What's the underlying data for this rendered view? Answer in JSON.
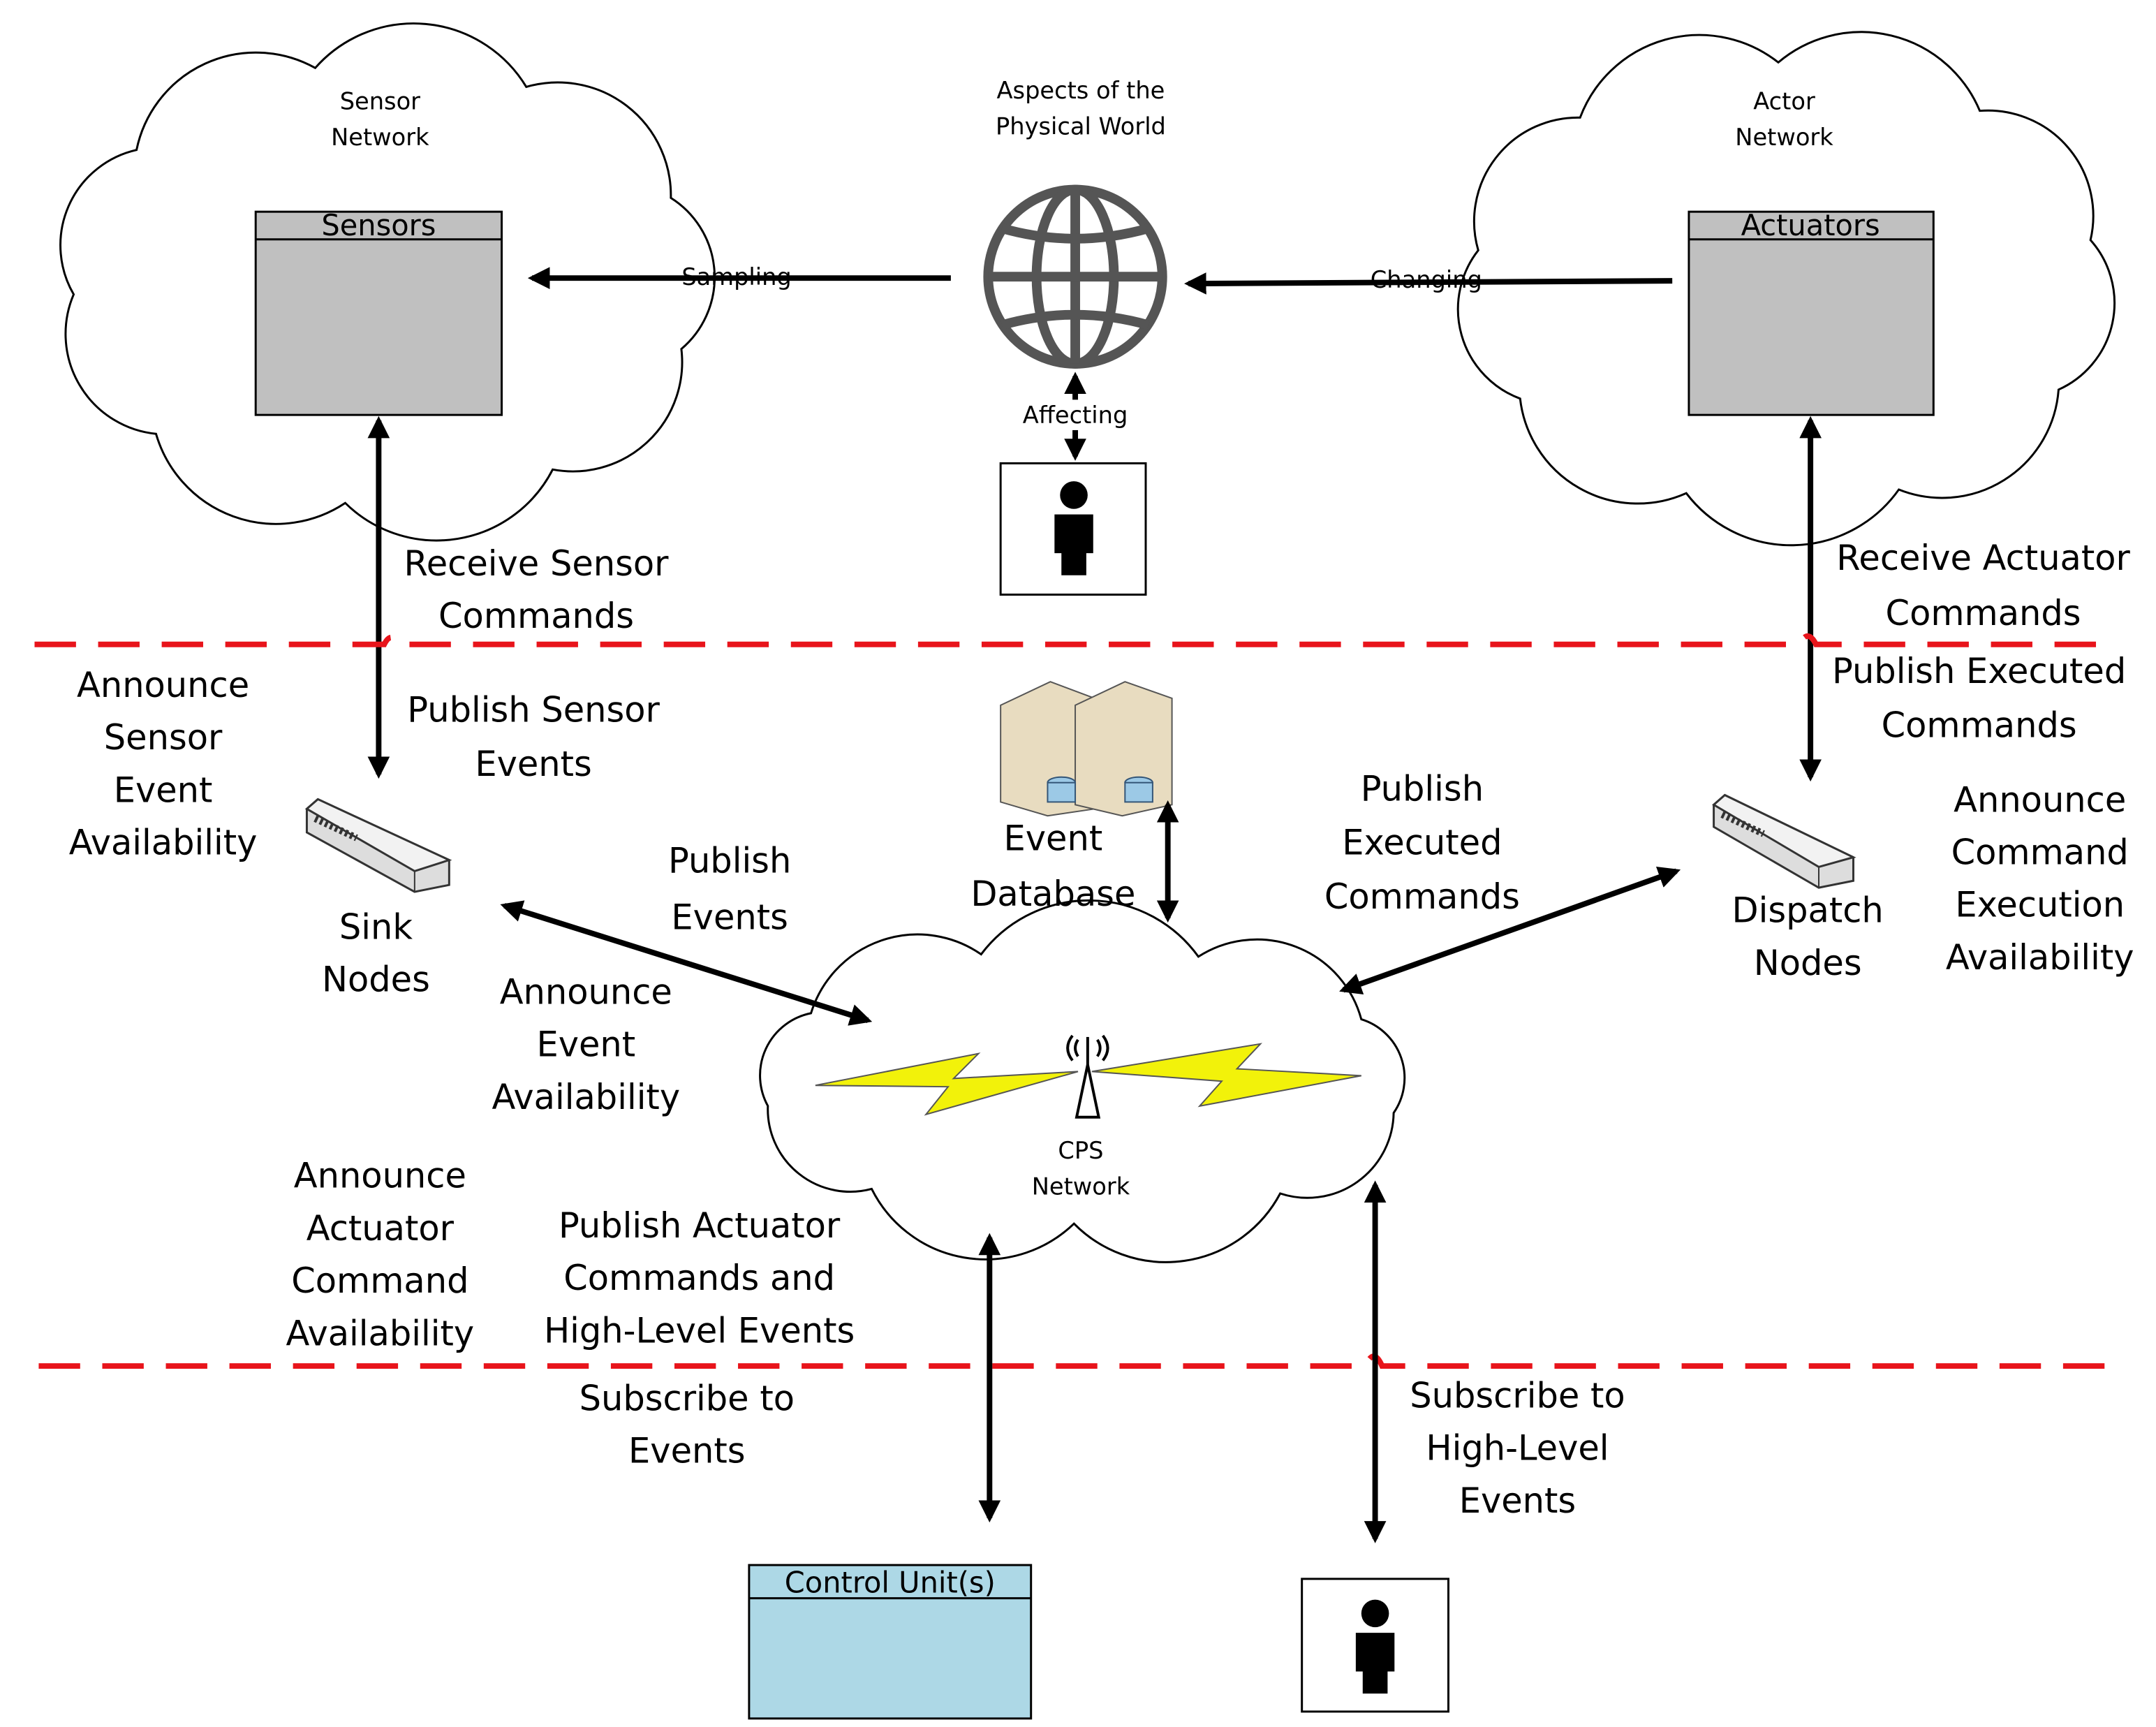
{
  "clouds": {
    "sensor_network": [
      "Sensor",
      "Network"
    ],
    "actor_network": [
      "Actor",
      "Network"
    ],
    "cps_network": [
      "CPS",
      "Network"
    ]
  },
  "physical_world": [
    "Aspects of the",
    "Physical World"
  ],
  "boxes": {
    "sensors": "Sensors",
    "actuators": "Actuators",
    "control_units": "Control Unit(s)"
  },
  "arrow_labels": {
    "sampling": "Sampling",
    "changing": "Changing",
    "affecting": "Affecting"
  },
  "nodes": {
    "sink": [
      "Sink",
      "Nodes"
    ],
    "dispatch": [
      "Dispatch",
      "Nodes"
    ],
    "event_database": [
      "Event",
      "Database"
    ]
  },
  "labels": {
    "receive_sensor_commands": [
      "Receive Sensor",
      "Commands"
    ],
    "publish_sensor_events": [
      "Publish Sensor",
      "Events"
    ],
    "announce_sensor_event": [
      "Announce",
      "Sensor",
      "Event",
      "Availability"
    ],
    "publish_events": [
      "Publish",
      "Events"
    ],
    "announce_event": [
      "Announce",
      "Event",
      "Availability"
    ],
    "receive_actuator_commands": [
      "Receive Actuator",
      "Commands"
    ],
    "publish_executed_commands_top": [
      "Publish Executed",
      "Commands"
    ],
    "announce_command_execution": [
      "Announce",
      "Command",
      "Execution",
      "Availability"
    ],
    "publish_executed_commands": [
      "Publish",
      "Executed",
      "Commands"
    ],
    "announce_actuator_command": [
      "Announce",
      "Actuator",
      "Command",
      "Availability"
    ],
    "publish_actuator_commands": [
      "Publish Actuator",
      "Commands and",
      "High-Level Events"
    ],
    "subscribe_events": [
      "Subscribe to",
      "Events"
    ],
    "subscribe_high_level": [
      "Subscribe to",
      "High-Level",
      "Events"
    ]
  },
  "colors": {
    "zone_divider": "#e8141b",
    "device_box": "#c0c0c0",
    "control_unit": "#add8e6",
    "lightning": "#f2f20a"
  }
}
